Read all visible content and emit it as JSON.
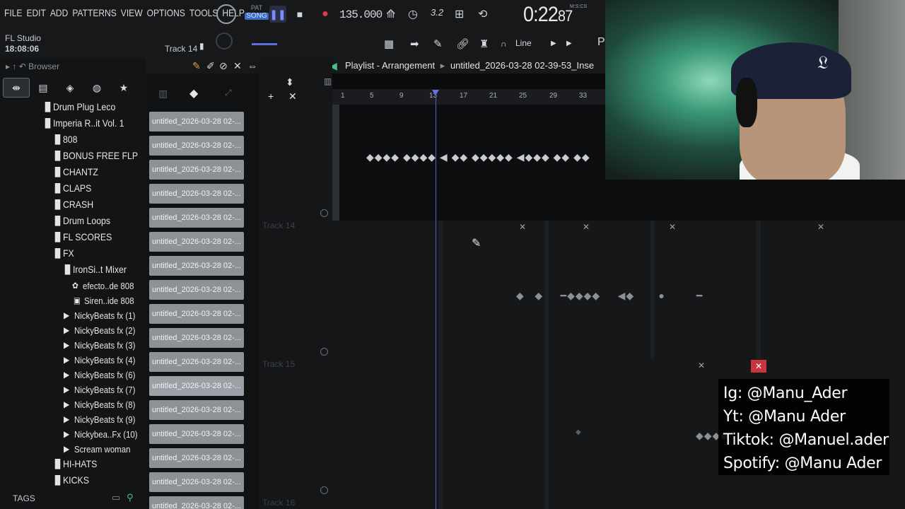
{
  "menu": [
    "FILE",
    "EDIT",
    "ADD",
    "PATTERNS",
    "VIEW",
    "OPTIONS",
    "TOOLS",
    "HELP"
  ],
  "transport": {
    "pat": "PAT",
    "song": "SONG",
    "tempo": "135.000",
    "step": "3.2",
    "time": "0:22",
    "time_sub": "87",
    "time_unit": "M:S:CS"
  },
  "info": {
    "app": "FL Studio",
    "clock": "18:08:06",
    "track": "Track 14",
    "snap": "Line",
    "pa": "Pa"
  },
  "browser": {
    "title": "Browser",
    "items": [
      "Drum Plug Leco",
      "Imperia R..it Vol. 1",
      "808",
      "BONUS FREE FLP",
      "CHANTZ",
      "CLAPS",
      "CRASH",
      "Drum Loops",
      "FL SCORES",
      "FX",
      "IronSi..t Mixer",
      "efecto..de 808",
      "Siren..ide 808",
      "NickyBeats fx (1)",
      "NickyBeats fx (2)",
      "NickyBeats fx (3)",
      "NickyBeats fx (4)",
      "NickyBeats fx (6)",
      "NickyBeats fx (7)",
      "NickyBeats fx (8)",
      "NickyBeats fx (9)",
      "Nickybea..Fx (10)",
      "Scream woman",
      "HI-HATS",
      "KICKS"
    ],
    "tags": "TAGS"
  },
  "playlist": {
    "title": "Playlist - Arrangement",
    "song": "untitled_2026-03-28 02-39-53_Inse",
    "ruler": [
      "1",
      "5",
      "9",
      "13",
      "17",
      "21",
      "25",
      "29",
      "33"
    ],
    "tracks": [
      "Track 14",
      "Track 15",
      "Track 16"
    ]
  },
  "clips": [
    "untitled_2026-03-28 02-...",
    "untitled_2026-03-28 02-...",
    "untitled_2026-03-28 02-...",
    "untitled_2026-03-28 02-...",
    "untitled_2026-03-28 02-...",
    "untitled_2026-03-28 02-...",
    "untitled_2026-03-28 02-...",
    "untitled_2026-03-28 02-...",
    "untitled_2026-03-28 02-...",
    "untitled_2026-03-28 02-...",
    "untitled_2026-03-28 02-...",
    "untitled_2026-03-28 02-...",
    "untitled_2026-03-28 02-...",
    "untitled_2026-03-28 02-...",
    "untitled_2026-03-28 02-...",
    "untitled_2026-03-28 02-...",
    "untitled_2026-03-28 02-..."
  ],
  "social": {
    "ig": "Ig: @Manu_Ader",
    "yt": "Yt: @Manu Ader",
    "tiktok": "Tiktok: @Manuel.ader",
    "spotify": "Spotify: @Manu Ader"
  },
  "colors": {
    "accent": "#5c6ee0",
    "record": "#e23a4a",
    "clip": "#8d9297",
    "danger": "#c7363f"
  }
}
